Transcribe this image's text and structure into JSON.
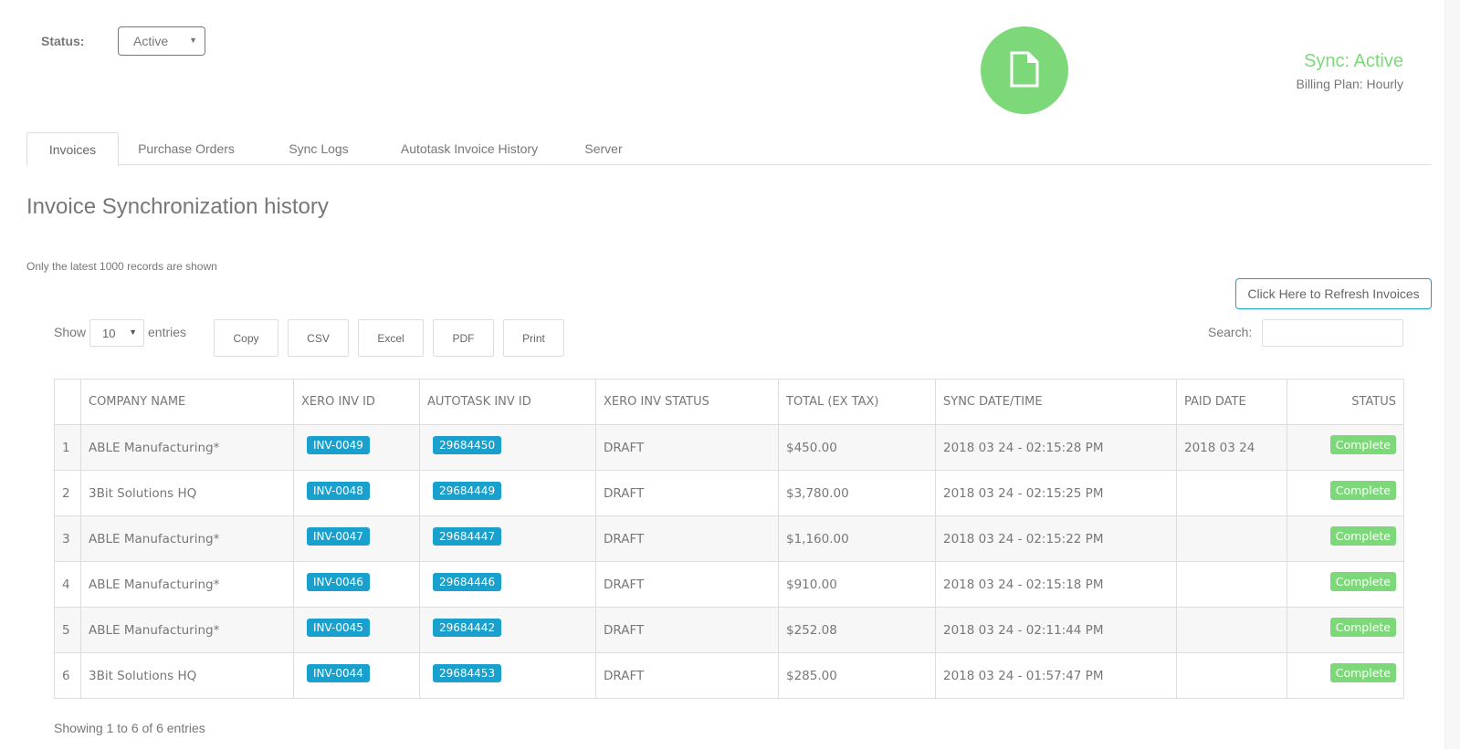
{
  "header": {
    "status_label": "Status:",
    "status_value": "Active",
    "sync_icon": "document-icon",
    "sync_status": "Sync: Active",
    "billing_plan": "Billing Plan: Hourly",
    "accent_green": "#7dd87a",
    "accent_blue": "#1aa0cc"
  },
  "tabs": [
    {
      "label": "Invoices",
      "active": true
    },
    {
      "label": "Purchase Orders",
      "active": false
    },
    {
      "label": "Sync Logs",
      "active": false
    },
    {
      "label": "Autotask Invoice History",
      "active": false
    },
    {
      "label": "Server",
      "active": false
    }
  ],
  "main": {
    "title": "Invoice Synchronization history",
    "records_note": "Only the latest 1000 records are shown",
    "refresh_button": "Click Here to Refresh Invoices",
    "show_label": "Show",
    "page_length": "10",
    "entries_label": "entries",
    "export_buttons": [
      "Copy",
      "CSV",
      "Excel",
      "PDF",
      "Print"
    ],
    "search_label": "Search:",
    "search_value": "",
    "showing_info": "Showing 1 to 6 of 6 entries"
  },
  "table": {
    "columns": [
      "",
      "COMPANY NAME",
      "XERO INV ID",
      "AUTOTASK INV ID",
      "XERO INV STATUS",
      "TOTAL (EX TAX)",
      "SYNC DATE/TIME",
      "PAID DATE",
      "STATUS"
    ],
    "rows": [
      {
        "n": "1",
        "company": "ABLE Manufacturing*",
        "xero_id": "INV-0049",
        "autotask_id": "29684450",
        "xero_status": "DRAFT",
        "total": "$450.00",
        "sync": "2018 03 24 - 02:15:28 PM",
        "paid": "2018 03 24",
        "status": "Complete"
      },
      {
        "n": "2",
        "company": "3Bit Solutions HQ",
        "xero_id": "INV-0048",
        "autotask_id": "29684449",
        "xero_status": "DRAFT",
        "total": "$3,780.00",
        "sync": "2018 03 24 - 02:15:25 PM",
        "paid": "",
        "status": "Complete"
      },
      {
        "n": "3",
        "company": "ABLE Manufacturing*",
        "xero_id": "INV-0047",
        "autotask_id": "29684447",
        "xero_status": "DRAFT",
        "total": "$1,160.00",
        "sync": "2018 03 24 - 02:15:22 PM",
        "paid": "",
        "status": "Complete"
      },
      {
        "n": "4",
        "company": "ABLE Manufacturing*",
        "xero_id": "INV-0046",
        "autotask_id": "29684446",
        "xero_status": "DRAFT",
        "total": "$910.00",
        "sync": "2018 03 24 - 02:15:18 PM",
        "paid": "",
        "status": "Complete"
      },
      {
        "n": "5",
        "company": "ABLE Manufacturing*",
        "xero_id": "INV-0045",
        "autotask_id": "29684442",
        "xero_status": "DRAFT",
        "total": "$252.08",
        "sync": "2018 03 24 - 02:11:44 PM",
        "paid": "",
        "status": "Complete"
      },
      {
        "n": "6",
        "company": "3Bit Solutions HQ",
        "xero_id": "INV-0044",
        "autotask_id": "29684453",
        "xero_status": "DRAFT",
        "total": "$285.00",
        "sync": "2018 03 24 - 01:57:47 PM",
        "paid": "",
        "status": "Complete"
      }
    ]
  }
}
